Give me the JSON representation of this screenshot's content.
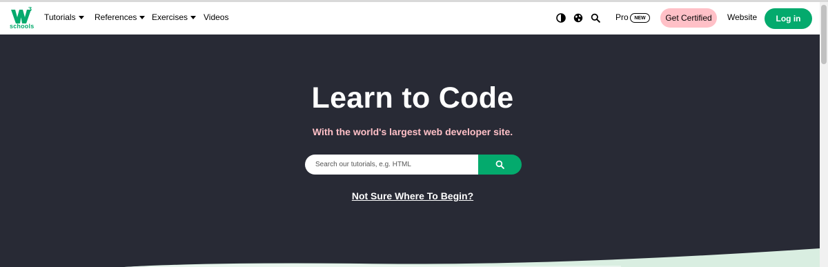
{
  "brand": {
    "logo_text": "schools",
    "logo_superscript": "3",
    "accent_color": "#04aa6d",
    "pink_color": "#ffc0c7",
    "hero_bg": "#282a35"
  },
  "navbar": {
    "menu": [
      {
        "label": "Tutorials",
        "has_dropdown": true
      },
      {
        "label": "References",
        "has_dropdown": true
      },
      {
        "label": "Exercises",
        "has_dropdown": true
      },
      {
        "label": "Videos",
        "has_dropdown": false
      }
    ],
    "icons": [
      "contrast-icon",
      "globe-icon",
      "search-icon"
    ],
    "pro_label": "Pro",
    "new_badge": "NEW",
    "certified_label": "Get Certified",
    "website_label": "Website",
    "login_label": "Log in"
  },
  "hero": {
    "title": "Learn to Code",
    "subtitle": "With the world's largest web developer site.",
    "search_placeholder": "Search our tutorials, e.g. HTML",
    "search_icon": "search-icon",
    "not_sure_link": "Not Sure Where To Begin?"
  }
}
